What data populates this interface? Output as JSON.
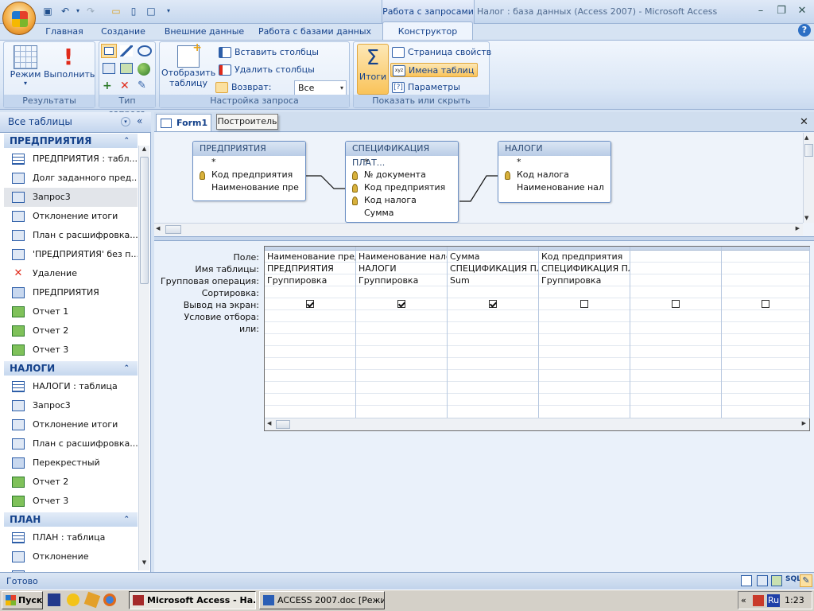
{
  "titlebar": {
    "context_tab": "Работа с запросами",
    "window_title": "Налог : база данных (Access 2007) - Microsoft Access"
  },
  "tabs": [
    "Главная",
    "Создание",
    "Внешние данные",
    "Работа с базами данных",
    "Конструктор"
  ],
  "ribbon": {
    "results": {
      "label": "Результаты",
      "mode": "Режим",
      "run": "Выполнить"
    },
    "query_type": {
      "label": "Тип запроса"
    },
    "setup": {
      "label": "Настройка запроса",
      "show_table": "Отобразить таблицу",
      "insert_cols": "Вставить столбцы",
      "delete_cols": "Удалить столбцы",
      "return_label": "Возврат:",
      "return_value": "Все"
    },
    "show_hide": {
      "label": "Показать или скрыть",
      "totals": "Итоги",
      "props": "Страница свойств",
      "table_names": "Имена таблиц",
      "params": "Параметры"
    }
  },
  "nav": {
    "header": "Все таблицы",
    "sections": [
      {
        "title": "ПРЕДПРИЯТИЯ",
        "items": [
          "ПРЕДПРИЯТИЯ : табл...",
          "Долг заданного пред...",
          "Запрос3",
          "Отклонение итоги",
          "План с расшифровка...",
          "'ПРЕДПРИЯТИЯ' без п...",
          "Удаление",
          "ПРЕДПРИЯТИЯ",
          "Отчет 1",
          "Отчет 2",
          "Отчет 3"
        ]
      },
      {
        "title": "НАЛОГИ",
        "items": [
          "НАЛОГИ : таблица",
          "Запрос3",
          "Отклонение итоги",
          "План с расшифровка...",
          "Перекрестный",
          "Отчет 2",
          "Отчет 3"
        ]
      },
      {
        "title": "ПЛАН",
        "items": [
          "ПЛАН : таблица",
          "Отклонение",
          "Отклонение итоги"
        ]
      }
    ]
  },
  "document": {
    "tab": "Form1",
    "tooltip": "Построитель"
  },
  "tables": [
    {
      "title": "ПРЕДПРИЯТИЯ",
      "fields": [
        {
          "name": "*",
          "key": false
        },
        {
          "name": "Код предприятия",
          "key": true
        },
        {
          "name": "Наименование пре",
          "key": false
        }
      ]
    },
    {
      "title": "СПЕЦИФИКАЦИЯ ПЛАТ...",
      "fields": [
        {
          "name": "*",
          "key": false
        },
        {
          "name": "№ документа",
          "key": true
        },
        {
          "name": "Код предприятия",
          "key": true
        },
        {
          "name": "Код налога",
          "key": true
        },
        {
          "name": "Сумма",
          "key": false
        }
      ]
    },
    {
      "title": "НАЛОГИ",
      "fields": [
        {
          "name": "*",
          "key": false
        },
        {
          "name": "Код налога",
          "key": true
        },
        {
          "name": "Наименование нал",
          "key": false
        }
      ]
    }
  ],
  "grid": {
    "row_labels": [
      "Поле:",
      "Имя таблицы:",
      "Групповая операция:",
      "Сортировка:",
      "Вывод на экран:",
      "Условие отбора:",
      "или:"
    ],
    "columns": [
      {
        "field": "Наименование пред",
        "table": "ПРЕДПРИЯТИЯ",
        "group": "Группировка",
        "show": true
      },
      {
        "field": "Наименование нало",
        "table": "НАЛОГИ",
        "group": "Группировка",
        "show": true
      },
      {
        "field": "Сумма",
        "table": "СПЕЦИФИКАЦИЯ ПЛА",
        "group": "Sum",
        "show": true
      },
      {
        "field": "Код предприятия",
        "table": "СПЕЦИФИКАЦИЯ ПЛА",
        "group": "Группировка",
        "show": false
      },
      {
        "field": "",
        "table": "",
        "group": "",
        "show": false
      },
      {
        "field": "",
        "table": "",
        "group": "",
        "show": false
      }
    ]
  },
  "status": {
    "text": "Готово",
    "sql": "SQL"
  },
  "taskbar": {
    "start": "Пуск",
    "apps": [
      "Microsoft Access - На...",
      "ACCESS 2007.doc [Режи..."
    ],
    "lang": "Ru",
    "time": "1:23"
  }
}
